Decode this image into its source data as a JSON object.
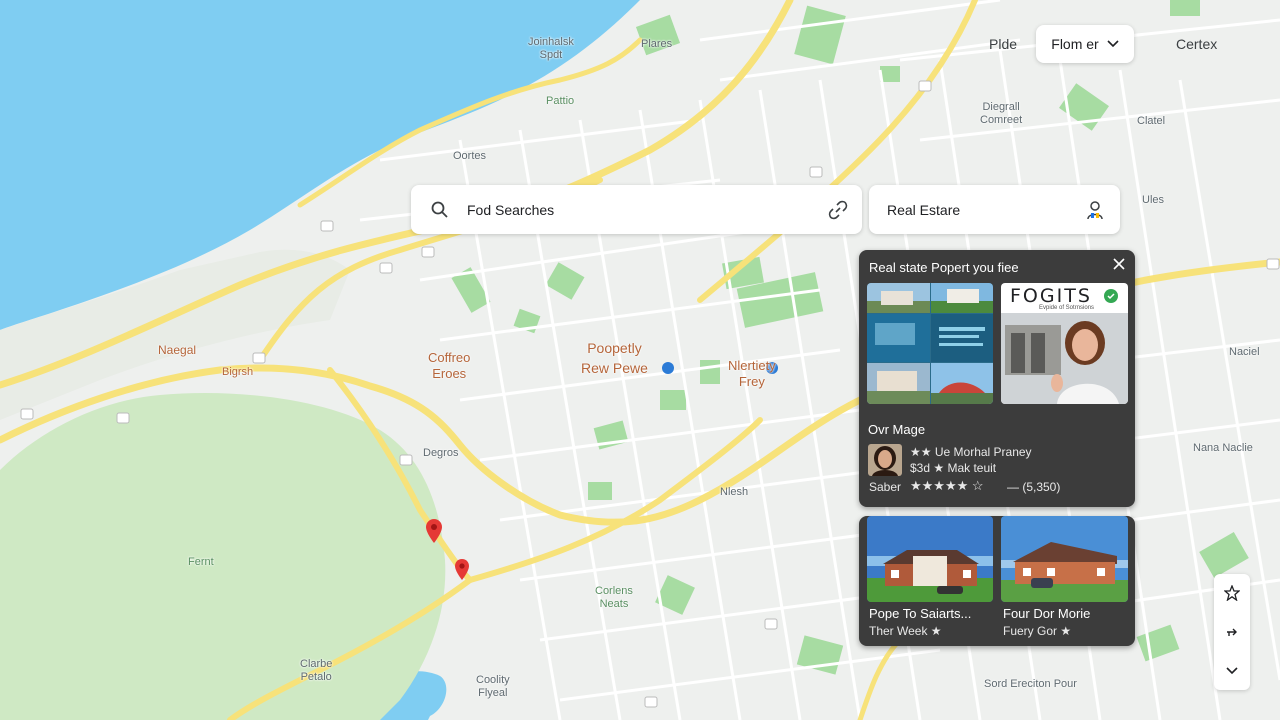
{
  "search": {
    "value": "Fod Searches"
  },
  "filter": {
    "value": "Real Estare"
  },
  "top_bar": {
    "left_label": "Plde",
    "dropdown_label": "Flom er",
    "right_label": "Certex"
  },
  "info_panel": {
    "header": "Real state Popert you fiee",
    "logo_text": "FOGITS",
    "logo_sub": "Evpide of Sotrnsions",
    "section_title": "Ovr Mage",
    "agent_name_line": "★★ Ue Morhal Praney",
    "agent_sub_line": "$3d ★ Mak teuit",
    "rating_prefix": "Saber",
    "rating_stars": "★★★★★ ☆",
    "rating_count": "— (5,350)"
  },
  "listings": [
    {
      "title": "Pope To Saiarts...",
      "subtitle": "Ther Week ★"
    },
    {
      "title": "Four Dor Morie",
      "subtitle": "Fuery Gor ★"
    }
  ],
  "map_labels": {
    "jonhalsk": "Joinhalsk\nSpdt",
    "plares": "Plares",
    "pattio": "Pattio",
    "dongrall": "Diegrall\nComreet",
    "clatel": "Clatel",
    "ontes": "Oortes",
    "naegal": "Naegal",
    "bigrsh": "Bigrsh",
    "coffreo": "Coffreo\nEroes",
    "poopety": "Poopetly\nRew Pewe",
    "nlerte": "Nlertiety\nFrey",
    "degros": "Degros",
    "nlesh": "Nlesh",
    "fernt": "Fernt",
    "corlens": "Corlens\nNeats",
    "clarbe": "Clarbe\nPetalo",
    "coolly": "Coolity\nFlyeal",
    "nacdiel": "Naciel",
    "nana": "Nana Naclie",
    "sord": "Sord Ereciton Pour",
    "ules": "Ules"
  },
  "controls": [
    {
      "icon": "star-outline-icon"
    },
    {
      "icon": "direction-icon"
    },
    {
      "icon": "chevron-down-icon"
    }
  ],
  "colors": {
    "water": "#7fcdf2",
    "land": "#eef0ee",
    "park": "#a7dca2",
    "highway": "#f7e27a",
    "road": "#ffffff",
    "panel": "#3c3c3c",
    "pin": "#e53935",
    "transit": "#2b7bd6"
  }
}
